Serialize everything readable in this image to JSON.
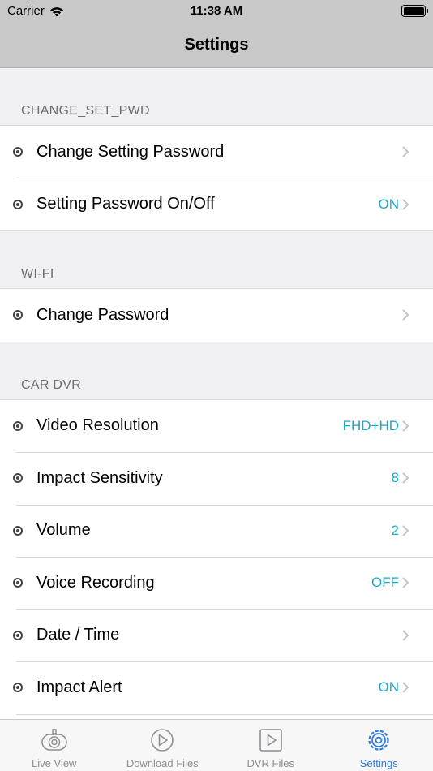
{
  "status_bar": {
    "carrier": "Carrier",
    "time": "11:38 AM"
  },
  "nav": {
    "title": "Settings"
  },
  "sections": [
    {
      "header": "CHANGE_SET_PWD",
      "rows": [
        {
          "label": "Change Setting Password",
          "value": ""
        },
        {
          "label": "Setting Password On/Off",
          "value": "ON"
        }
      ]
    },
    {
      "header": "WI-FI",
      "rows": [
        {
          "label": "Change Password",
          "value": ""
        }
      ]
    },
    {
      "header": "CAR DVR",
      "rows": [
        {
          "label": "Video Resolution",
          "value": "FHD+HD"
        },
        {
          "label": "Impact Sensitivity",
          "value": "8"
        },
        {
          "label": "Volume",
          "value": "2"
        },
        {
          "label": "Voice Recording",
          "value": "OFF"
        },
        {
          "label": "Date / Time",
          "value": ""
        },
        {
          "label": "Impact Alert",
          "value": "ON"
        }
      ]
    }
  ],
  "tabs": [
    {
      "label": "Live View",
      "icon": "dashcam-icon"
    },
    {
      "label": "Download Files",
      "icon": "play-circle-icon"
    },
    {
      "label": "DVR Files",
      "icon": "play-square-icon"
    },
    {
      "label": "Settings",
      "icon": "gear-icon"
    }
  ],
  "colors": {
    "accent": "#2f7ae5",
    "value": "#1aa9c8",
    "nav_background": "#c8c8c8",
    "group_background": "#efeff4"
  }
}
